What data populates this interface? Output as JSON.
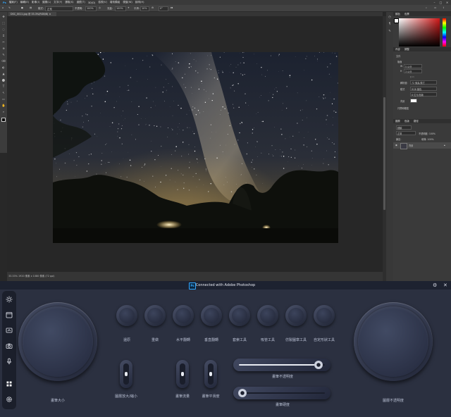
{
  "photoshop": {
    "menu": [
      "檔案(F)",
      "編輯(E)",
      "影像(I)",
      "圖層(L)",
      "文字(Y)",
      "選取(S)",
      "濾鏡(T)",
      "3D(D)",
      "檢視(V)",
      "增效模組",
      "視窗(W)",
      "說明(H)"
    ],
    "options": {
      "mode_label": "模式:",
      "mode_value": "正常",
      "opacity_label": "不透明:",
      "opacity_value": "100%",
      "flow_label": "流量:",
      "flow_value": "100%",
      "smooth_label": "平滑:",
      "smooth_value": "10%",
      "angle_value": "0°"
    },
    "doc_tab": "DSC_0011.jpg @ 33.3%(RGB/8)",
    "status": "33.33%   1920 像素 x 1080 像素 (72 ppi)",
    "panels": {
      "color_tabs": [
        "顏色",
        "色票"
      ],
      "props_tabs": [
        "內容",
        "調整"
      ],
      "props_title": "文件",
      "canvas_label": "版面",
      "w_label": "W",
      "w_value": "5 公分",
      "h_label": "H",
      "h_value": "3 公分",
      "res_label": "解析度:",
      "res_value": "72 像素/英寸",
      "mode_label": "模式",
      "mode_value": "RGB 顏色",
      "depth_value": "8 位元/色版",
      "bg_label": "背景",
      "rulers_label": "尺標和格點",
      "layer_tabs": [
        "圖層",
        "色版",
        "路徑"
      ],
      "layer_kind": "種類",
      "layer_blend": "正常",
      "layer_opacity": "不透明度: 100%",
      "layer_lock": "鎖定:",
      "layer_fill": "填滿: 100%",
      "layer_name": "背景"
    }
  },
  "control_panel": {
    "title": "Connected with Adobe Photoshop",
    "logo": "Ps",
    "left_knob_label": "畫筆大小",
    "right_knob_label": "圖層不透明度",
    "buttons": [
      "還原",
      "重做",
      "水平翻轉",
      "垂直翻轉",
      "套索工具",
      "吸管工具",
      "仿製圖章工具",
      "自定形狀工具"
    ],
    "toggles": [
      "圖層放大/縮小",
      "畫筆流量",
      "畫筆平滑度"
    ],
    "sliders": [
      {
        "label": "畫筆不透明度",
        "value": 0.93
      },
      {
        "label": "畫筆硬度",
        "value": 0.04
      }
    ]
  }
}
